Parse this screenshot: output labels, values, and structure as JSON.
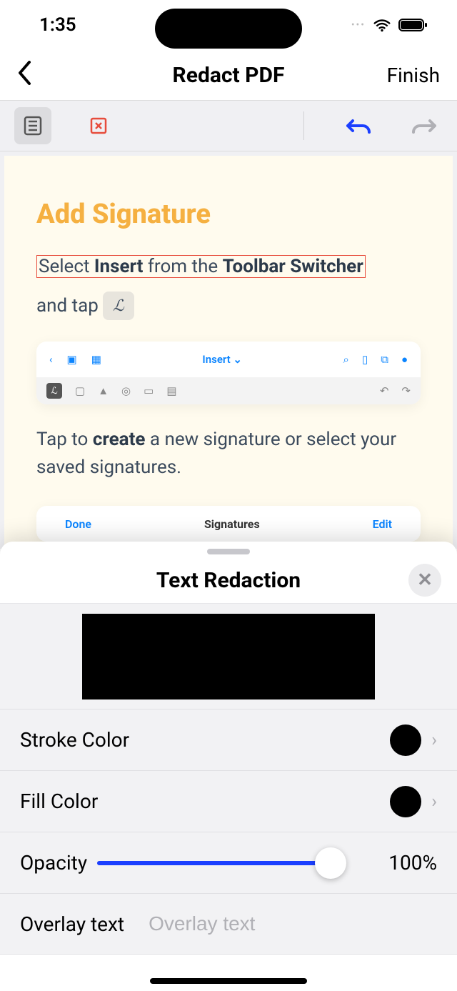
{
  "status": {
    "time": "1:35"
  },
  "nav": {
    "title": "Redact PDF",
    "finish": "Finish"
  },
  "doc": {
    "heading": "Add Signature",
    "line1_prefix": "Select ",
    "line1_bold1": "Insert",
    "line1_mid": " from the ",
    "line1_bold2": "Toolbar Switcher",
    "line2_prefix": "and tap ",
    "embedded_center": "Insert ⌄",
    "line3_a": "Tap to ",
    "line3_bold": "create",
    "line3_b": " a new signature or select your saved signatures.",
    "emb2_done": "Done",
    "emb2_title": "Signatures",
    "emb2_edit": "Edit"
  },
  "sheet": {
    "title": "Text Redaction",
    "rows": {
      "stroke_label": "Stroke Color",
      "fill_label": "Fill Color",
      "opacity_label": "Opacity",
      "opacity_value": "100%",
      "overlay_label": "Overlay text",
      "overlay_placeholder": "Overlay text"
    },
    "colors": {
      "stroke": "#000000",
      "fill": "#000000"
    },
    "opacity_percent": 100
  }
}
